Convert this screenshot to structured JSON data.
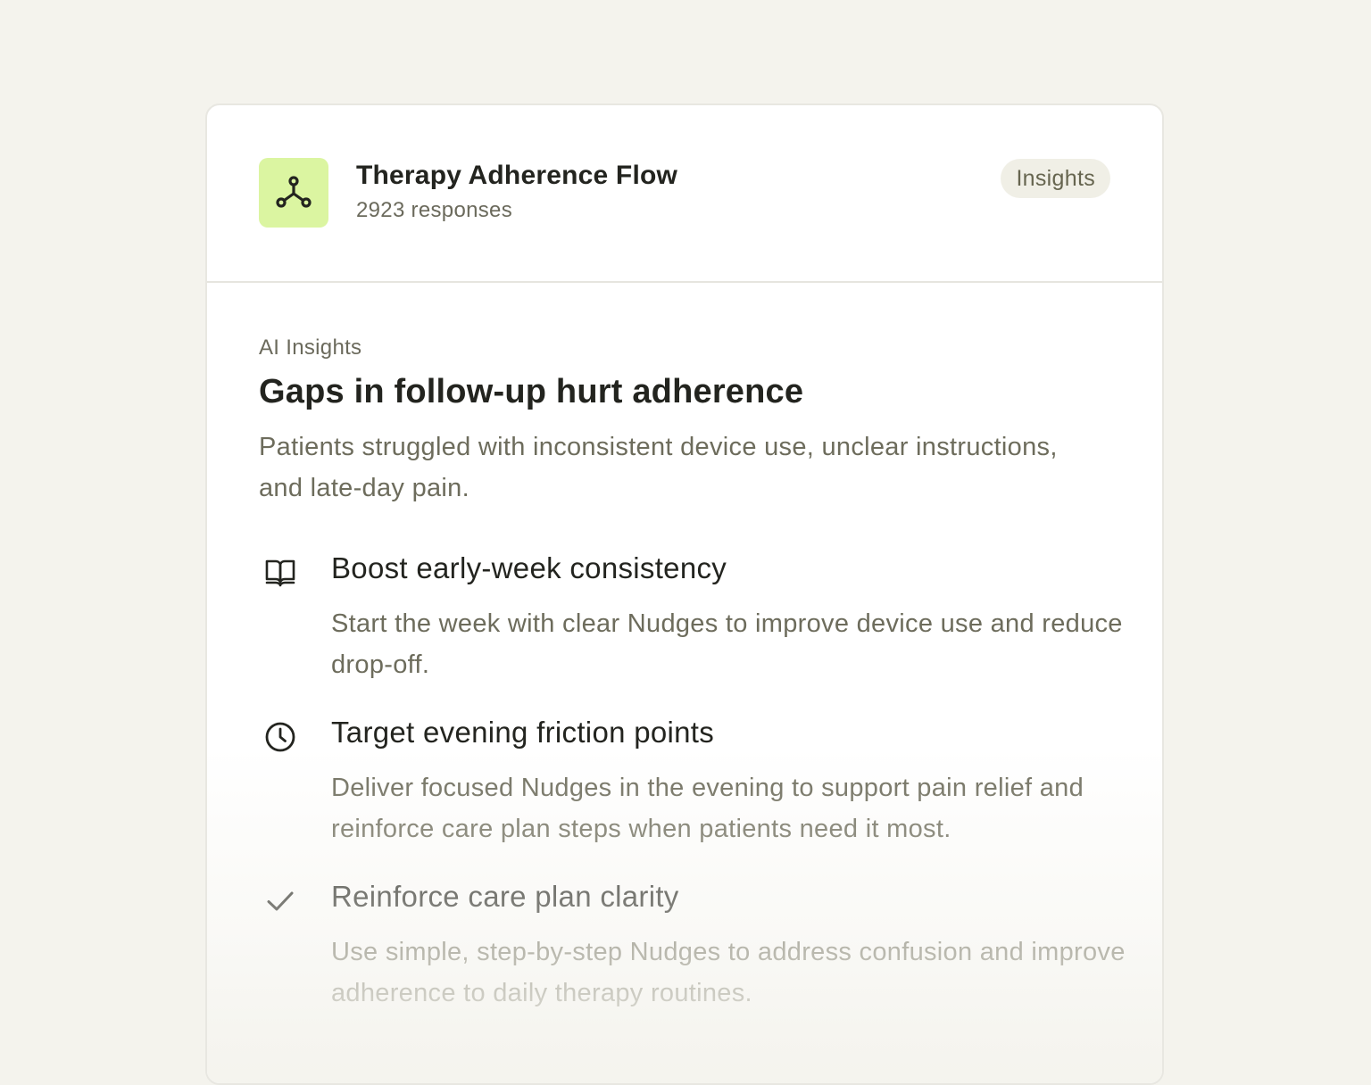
{
  "header": {
    "icon": "flow-branch-icon",
    "icon_bg": "#dbf5a1",
    "title": "Therapy Adherence Flow",
    "responses": "2923 responses",
    "badge": "Insights"
  },
  "insights": {
    "eyebrow": "AI Insights",
    "headline": "Gaps in follow-up hurt adherence",
    "summary": "Patients struggled with inconsistent device use, unclear instructions, and late-day pain.",
    "recommendations": [
      {
        "icon": "open-book-icon",
        "title": "Boost early-week consistency",
        "body": "Start the week with clear Nudges to improve device use and reduce drop-off."
      },
      {
        "icon": "clock-icon",
        "title": "Target evening friction points",
        "body": "Deliver focused Nudges in the evening to support pain relief and reinforce care plan steps when patients need it most."
      },
      {
        "icon": "checkmark-icon",
        "title": "Reinforce care plan clarity",
        "body": "Use simple, step-by-step Nudges to address confusion and improve adherence to daily therapy routines."
      }
    ]
  },
  "colors": {
    "background": "#f4f3ed",
    "card": "#ffffff",
    "text_primary": "#23241f",
    "text_secondary": "#6d6c5c",
    "badge_bg": "#f0efe6"
  }
}
